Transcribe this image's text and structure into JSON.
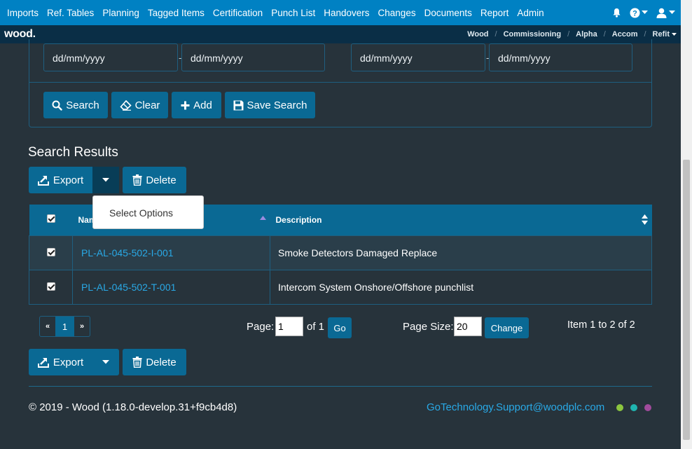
{
  "nav": {
    "items": [
      "Imports",
      "Ref. Tables",
      "Planning",
      "Tagged Items",
      "Certification",
      "Punch List",
      "Handovers",
      "Changes",
      "Documents",
      "Report",
      "Admin"
    ]
  },
  "brand": {
    "logo": "wood."
  },
  "breadcrumb": {
    "items": [
      "Wood",
      "Commissioning",
      "Alpha",
      "Accom",
      "Refit"
    ]
  },
  "search_panel": {
    "date_placeholders": [
      "dd/mm/yyyy",
      "dd/mm/yyyy",
      "dd/mm/yyyy",
      "dd/mm/yyyy"
    ],
    "buttons": {
      "search": "Search",
      "clear": "Clear",
      "add": "Add",
      "save_search": "Save Search"
    }
  },
  "results": {
    "heading": "Search Results",
    "export_label": "Export",
    "delete_label": "Delete",
    "dropdown_option": "Select Options",
    "columns": {
      "name": "Name",
      "description": "Description"
    },
    "rows": [
      {
        "checked": true,
        "name": "PL-AL-045-502-I-001",
        "description": "Smoke Detectors Damaged Replace"
      },
      {
        "checked": true,
        "name": "PL-AL-045-502-T-001",
        "description": "Intercom System Onshore/Offshore punchlist"
      }
    ]
  },
  "pagination": {
    "prev": "«",
    "current": "1",
    "next": "»",
    "page_label": "Page:",
    "page_value": "1",
    "of_text": "of 1",
    "go_label": "Go",
    "page_size_label": "Page Size:",
    "page_size_value": "20",
    "change_label": "Change",
    "summary": "Item 1 to 2 of 2"
  },
  "footer": {
    "copyright": "© 2019 - Wood (1.18.0-develop.31+f9cb4d8)",
    "email": "GoTechnology.Support@woodplc.com"
  },
  "colors": {
    "nav_bg": "#0081c3",
    "subnav_bg": "#0a2e46",
    "page_bg": "#27333b",
    "button_bg": "#0a6994",
    "link": "#29a9e6",
    "dots": [
      "#8cc63f",
      "#1fb5b0",
      "#a14b9c"
    ]
  }
}
